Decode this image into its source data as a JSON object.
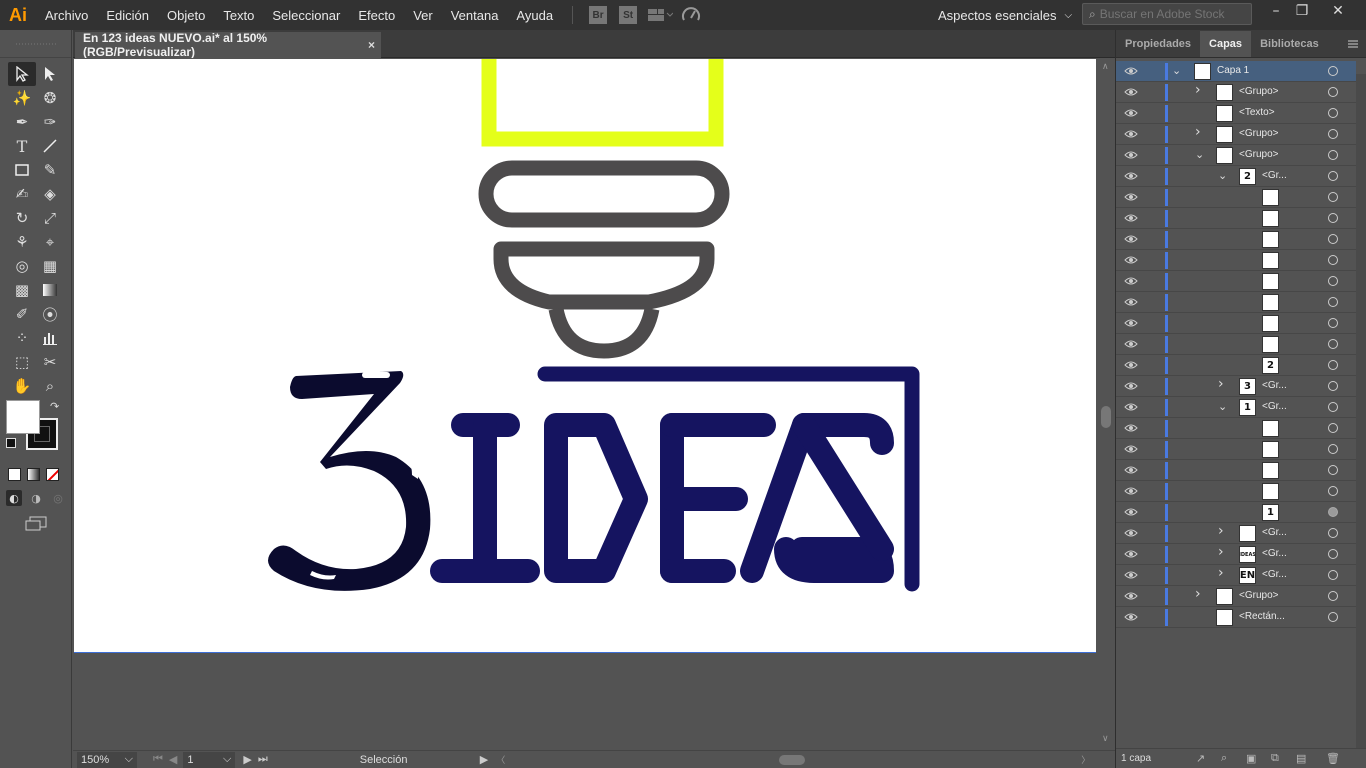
{
  "app": {
    "logo": "Ai",
    "accent": "#ff9a00"
  },
  "menu": [
    "Archivo",
    "Edición",
    "Objeto",
    "Texto",
    "Seleccionar",
    "Efecto",
    "Ver",
    "Ventana",
    "Ayuda"
  ],
  "menu_icons": {
    "bridge": "Br",
    "stock": "St"
  },
  "workspace": {
    "label": "Aspectos esenciales"
  },
  "search": {
    "placeholder": "Buscar en Adobe Stock"
  },
  "document": {
    "tab_title": "En 123 ideas NUEVO.ai* al 150% (RGB/Previsualizar)",
    "close": "×"
  },
  "artwork": {
    "number": "3",
    "word": "IDEAS",
    "colors": {
      "bulb_yellow": "#e4ff1a",
      "bulb_gray": "#4d4b4c",
      "navy": "#151460",
      "three_dark": "#0b0b2e"
    }
  },
  "status": {
    "zoom": "150%",
    "page": "1",
    "tool": "Selección"
  },
  "panel": {
    "tabs": [
      "Propiedades",
      "Capas",
      "Bibliotecas"
    ],
    "active_tab": "Capas",
    "footer": "1 capa",
    "layers": [
      {
        "name": "Capa 1",
        "thumb": "",
        "caret": "v"
      },
      {
        "name": "<Grupo>",
        "thumb": "",
        "caret": ">"
      },
      {
        "name": "<Texto>",
        "thumb": "",
        "caret": ""
      },
      {
        "name": "<Grupo>",
        "thumb": "",
        "caret": ">"
      },
      {
        "name": "<Grupo>",
        "thumb": "",
        "caret": "v"
      },
      {
        "name": "<Gr...",
        "thumb": "2",
        "caret": "v"
      },
      {
        "name": "",
        "thumb": "",
        "caret": ""
      },
      {
        "name": "",
        "thumb": "",
        "caret": ""
      },
      {
        "name": "",
        "thumb": "",
        "caret": ""
      },
      {
        "name": "",
        "thumb": "",
        "caret": ""
      },
      {
        "name": "",
        "thumb": "",
        "caret": ""
      },
      {
        "name": "",
        "thumb": "",
        "caret": ""
      },
      {
        "name": "",
        "thumb": "",
        "caret": ""
      },
      {
        "name": "",
        "thumb": "",
        "caret": ""
      },
      {
        "name": "",
        "thumb": "2",
        "caret": ""
      },
      {
        "name": "<Gr...",
        "thumb": "3",
        "caret": ">"
      },
      {
        "name": "<Gr...",
        "thumb": "1",
        "caret": "v"
      },
      {
        "name": "",
        "thumb": "",
        "caret": ""
      },
      {
        "name": "",
        "thumb": "",
        "caret": ""
      },
      {
        "name": "",
        "thumb": "",
        "caret": ""
      },
      {
        "name": "",
        "thumb": "",
        "caret": ""
      },
      {
        "name": "",
        "thumb": "1",
        "caret": ""
      },
      {
        "name": "<Gr...",
        "thumb": "",
        "caret": ">"
      },
      {
        "name": "<Gr...",
        "thumb": "IDEAS",
        "caret": ">"
      },
      {
        "name": "<Gr...",
        "thumb": "EN",
        "caret": ">"
      },
      {
        "name": "<Grupo>",
        "thumb": "",
        "caret": ">"
      },
      {
        "name": "<Rectán...",
        "thumb": "",
        "caret": ""
      }
    ]
  }
}
